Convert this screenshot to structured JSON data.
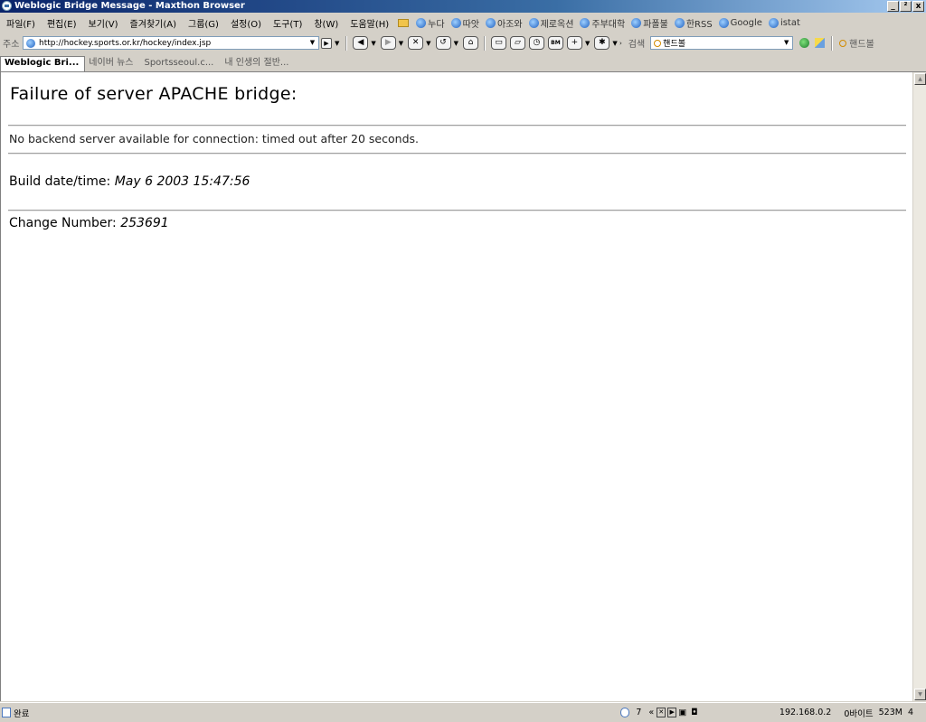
{
  "window": {
    "title": "Weblogic Bridge Message - Maxthon Browser",
    "controls": [
      "_",
      "²",
      "x"
    ]
  },
  "menu": {
    "items": [
      "파일(F)",
      "편집(E)",
      "보기(V)",
      "즐겨찾기(A)",
      "그룹(G)",
      "설정(O)",
      "도구(T)",
      "창(W)",
      "도움말(H)"
    ]
  },
  "links": {
    "items": [
      "누다",
      "따앗",
      "아조와",
      "제로옥션",
      "주부대학",
      "파폴불",
      "한RSS",
      "Google",
      "istat"
    ]
  },
  "toolbar": {
    "address_label": "주소",
    "url": "http://hockey.sports.or.kr/hockey/index.jsp",
    "search_label": "검색",
    "search_value": "핸드볼",
    "find_label": "핸드볼"
  },
  "tabs": [
    "Weblogic Bri...",
    "네이버 뉴스",
    "Sportsseoul.c...",
    "내 인생의 절반..."
  ],
  "page": {
    "heading": "Failure of server APACHE bridge:",
    "message": "No backend server available for connection: timed out after 20 seconds.",
    "build_label": "Build date/time:",
    "build_value": "May 6 2003 15:47:56",
    "change_label": "Change Number:",
    "change_value": "253691"
  },
  "status": {
    "text": "완료",
    "count": "7",
    "ip": "192.168.0.2",
    "bytes": "0바이트",
    "memory": "523M",
    "extra": "4"
  },
  "colors": {
    "titlebar": "#0a246a",
    "chrome": "#d4d0c8",
    "content_bg": "#ffffff"
  }
}
